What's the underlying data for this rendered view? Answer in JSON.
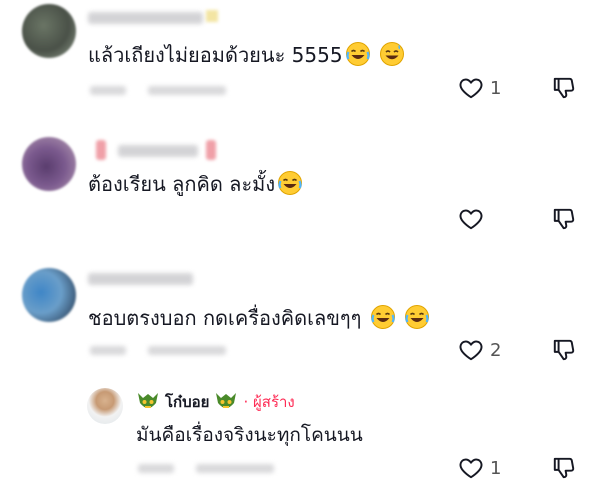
{
  "comments": [
    {
      "text": "แล้วเถียงไม่ยอมด้วยนะ 5555",
      "emojis": [
        "tears-of-joy-emoji",
        "grinning-sweat-emoji"
      ],
      "like_count": "1"
    },
    {
      "text": "ต้องเรียน ลูกคิด ละมั้ง",
      "emojis": [
        "tears-of-joy-emoji"
      ],
      "like_count": ""
    },
    {
      "text": "ชอบตรงบอก กดเครื่องคิดเลขๆๆ",
      "emojis": [
        "tears-of-joy-emoji",
        "tears-of-joy-emoji"
      ],
      "like_count": "2"
    }
  ],
  "reply": {
    "author": "โก๋บอย",
    "creator_label": "· ผู้สร้าง",
    "text": "มันคือเรื่องจริงนะทุกโคนนน",
    "like_count": "1"
  },
  "colors": {
    "creator": "#fe2c55",
    "text": "#161823",
    "icon": "#161823",
    "muted": "#d9d9db"
  },
  "icons": {
    "like": "heart-outline-icon",
    "dislike": "thumbs-down-outline-icon"
  }
}
